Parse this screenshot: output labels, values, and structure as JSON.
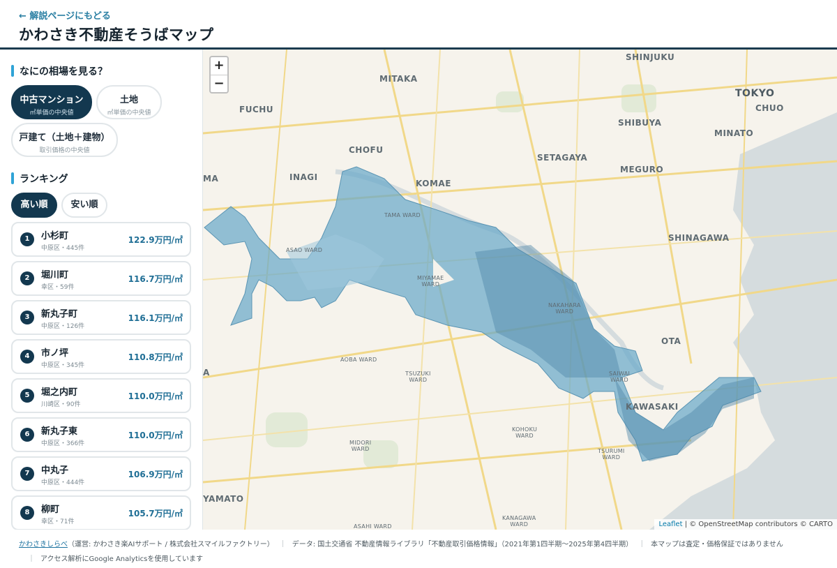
{
  "header": {
    "back_link": "← 解説ページにもどる",
    "title": "かわさき不動産そうばマップ"
  },
  "sidebar": {
    "type_section_title": "なにの相場を見る？",
    "types": [
      {
        "label": "中古マンション",
        "sub": "㎡単価の中央値",
        "active": true
      },
      {
        "label": "土地",
        "sub": "㎡単価の中央値",
        "active": false
      },
      {
        "label": "戸建て（土地＋建物）",
        "sub": "取引価格の中央値",
        "active": false
      }
    ],
    "ranking_title": "ランキング",
    "sort": {
      "high": "高い順",
      "low": "安い順"
    },
    "ranking": [
      {
        "rank": "1",
        "name": "小杉町",
        "meta": "中原区・445件",
        "price": "122.9万円/㎡"
      },
      {
        "rank": "2",
        "name": "堀川町",
        "meta": "幸区・59件",
        "price": "116.7万円/㎡"
      },
      {
        "rank": "3",
        "name": "新丸子町",
        "meta": "中原区・126件",
        "price": "116.1万円/㎡"
      },
      {
        "rank": "4",
        "name": "市ノ坪",
        "meta": "中原区・345件",
        "price": "110.8万円/㎡"
      },
      {
        "rank": "5",
        "name": "堀之内町",
        "meta": "川崎区・90件",
        "price": "110.0万円/㎡"
      },
      {
        "rank": "6",
        "name": "新丸子東",
        "meta": "中原区・366件",
        "price": "110.0万円/㎡"
      },
      {
        "rank": "7",
        "name": "中丸子",
        "meta": "中原区・444件",
        "price": "106.9万円/㎡"
      },
      {
        "rank": "8",
        "name": "柳町",
        "meta": "幸区・71件",
        "price": "105.7万円/㎡"
      }
    ]
  },
  "map": {
    "zoom_in": "+",
    "zoom_out": "−",
    "places": {
      "shinjuku": "SHINJUKU",
      "mitaka": "MITAKA",
      "tokyo": "TOKYO",
      "chuo": "CHUO",
      "fuchu": "FUCHU",
      "shibuya": "SHIBUYA",
      "minato": "MINATO",
      "chofu": "CHOFU",
      "setagaya": "SETAGAYA",
      "meguro": "MEGURO",
      "ma": "MA",
      "inagi": "INAGI",
      "komae": "KOMAE",
      "shinagawa": "SHINAGAWA",
      "ota": "OTA",
      "kawasaki": "KAWASAKI",
      "yamato": "YAMATO",
      "a": "A"
    },
    "wards": {
      "tama": "TAMA WARD",
      "asao": "ASAO WARD",
      "miyamae": "MIYAMAE\nWARD",
      "nakahara": "NAKAHARA\nWARD",
      "aoba": "AOBA WARD",
      "tsuzuki": "TSUZUKI\nWARD",
      "saiwai": "SAIWAI\nWARD",
      "kohoku": "KOHOKU\nWARD",
      "midori": "MIDORI\nWARD",
      "tsurumi": "TSURUMI\nWARD",
      "kanagawa": "KANAGAWA\nWARD",
      "asahi": "ASAHI WARD"
    },
    "attribution_leaflet": "Leaflet",
    "attribution_rest": " | © OpenStreetMap contributors © CARTO",
    "colors": {
      "choropleth": "#6aa9c9",
      "land": "#f6f3ec",
      "water": "#d4dadc"
    }
  },
  "footer": {
    "site_link": "かわさきしらべ",
    "operator": "（運営: かわさき楽AIサポート / 株式会社スマイルファクトリー）",
    "data_source": "データ: 国土交通省 不動産情報ライブラリ「不動産取引価格情報」（2021年第1四半期〜2025年第4四半期）",
    "disclaimer": "本マップは査定・価格保証ではありません",
    "separator": "｜",
    "analytics": "アクセス解析にGoogle Analyticsを使用しています"
  }
}
